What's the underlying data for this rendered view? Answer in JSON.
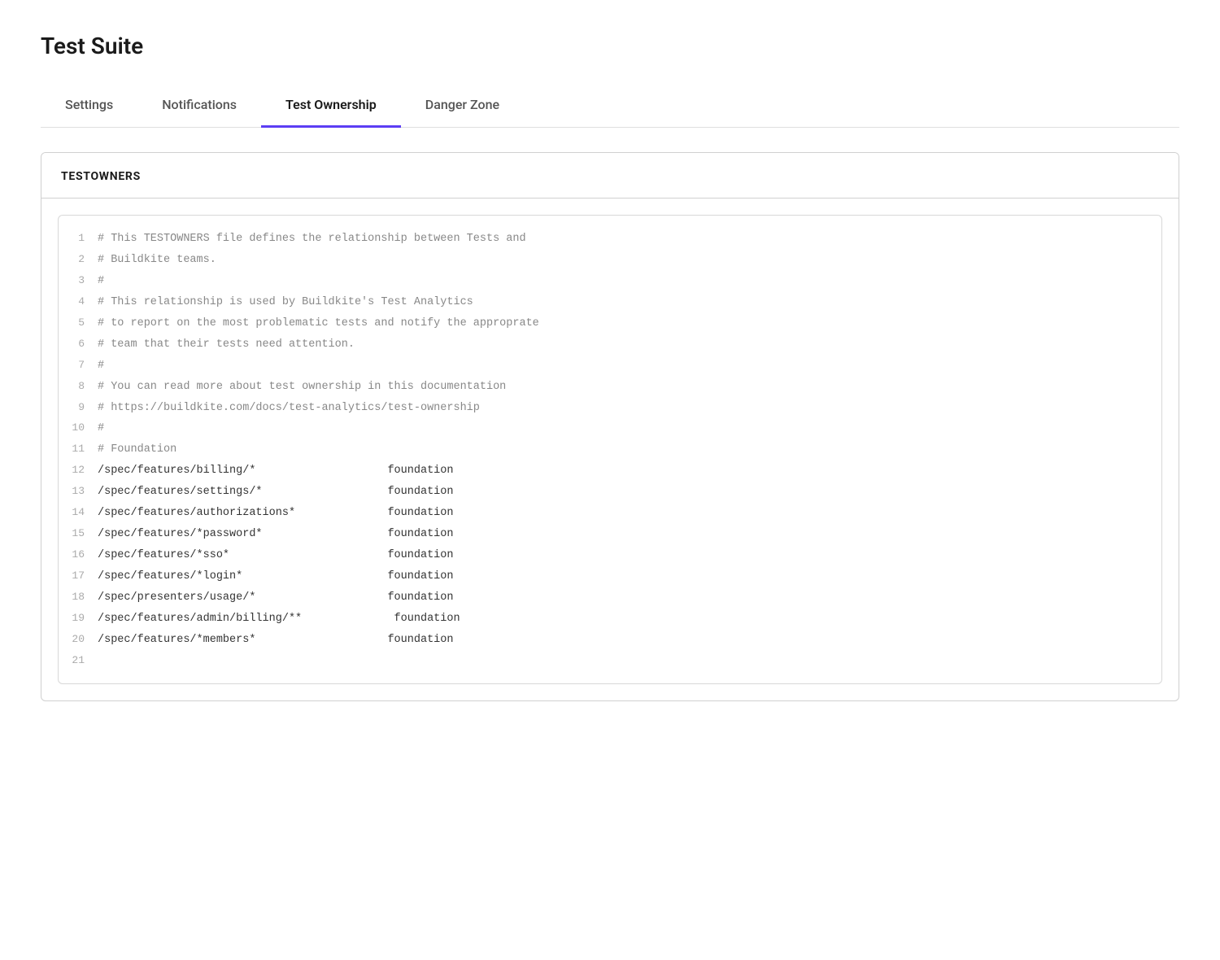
{
  "page": {
    "title": "Test Suite"
  },
  "tabs": [
    {
      "id": "settings",
      "label": "Settings",
      "active": false
    },
    {
      "id": "notifications",
      "label": "Notifications",
      "active": false
    },
    {
      "id": "test-ownership",
      "label": "Test Ownership",
      "active": true
    },
    {
      "id": "danger-zone",
      "label": "Danger Zone",
      "active": false
    }
  ],
  "card": {
    "header": "TESTOWNERS",
    "code_lines": [
      {
        "num": 1,
        "content": "# This TESTOWNERS file defines the relationship between Tests and",
        "type": "comment"
      },
      {
        "num": 2,
        "content": "# Buildkite teams.",
        "type": "comment"
      },
      {
        "num": 3,
        "content": "#",
        "type": "comment"
      },
      {
        "num": 4,
        "content": "# This relationship is used by Buildkite's Test Analytics",
        "type": "comment"
      },
      {
        "num": 5,
        "content": "# to report on the most problematic tests and notify the approprate",
        "type": "comment"
      },
      {
        "num": 6,
        "content": "# team that their tests need attention.",
        "type": "comment"
      },
      {
        "num": 7,
        "content": "#",
        "type": "comment"
      },
      {
        "num": 8,
        "content": "# You can read more about test ownership in this documentation",
        "type": "comment"
      },
      {
        "num": 9,
        "content": "# https://buildkite.com/docs/test-analytics/test-ownership",
        "type": "comment"
      },
      {
        "num": 10,
        "content": "#",
        "type": "comment"
      },
      {
        "num": 11,
        "content": "# Foundation",
        "type": "comment"
      },
      {
        "num": 12,
        "content": "/spec/features/billing/*                    foundation",
        "type": "code"
      },
      {
        "num": 13,
        "content": "/spec/features/settings/*                   foundation",
        "type": "code"
      },
      {
        "num": 14,
        "content": "/spec/features/authorizations*              foundation",
        "type": "code"
      },
      {
        "num": 15,
        "content": "/spec/features/*password*                   foundation",
        "type": "code"
      },
      {
        "num": 16,
        "content": "/spec/features/*sso*                        foundation",
        "type": "code"
      },
      {
        "num": 17,
        "content": "/spec/features/*login*                      foundation",
        "type": "code"
      },
      {
        "num": 18,
        "content": "/spec/presenters/usage/*                    foundation",
        "type": "code"
      },
      {
        "num": 19,
        "content": "/spec/features/admin/billing/**              foundation",
        "type": "code"
      },
      {
        "num": 20,
        "content": "/spec/features/*members*                    foundation",
        "type": "code"
      },
      {
        "num": 21,
        "content": "",
        "type": "code"
      }
    ]
  }
}
